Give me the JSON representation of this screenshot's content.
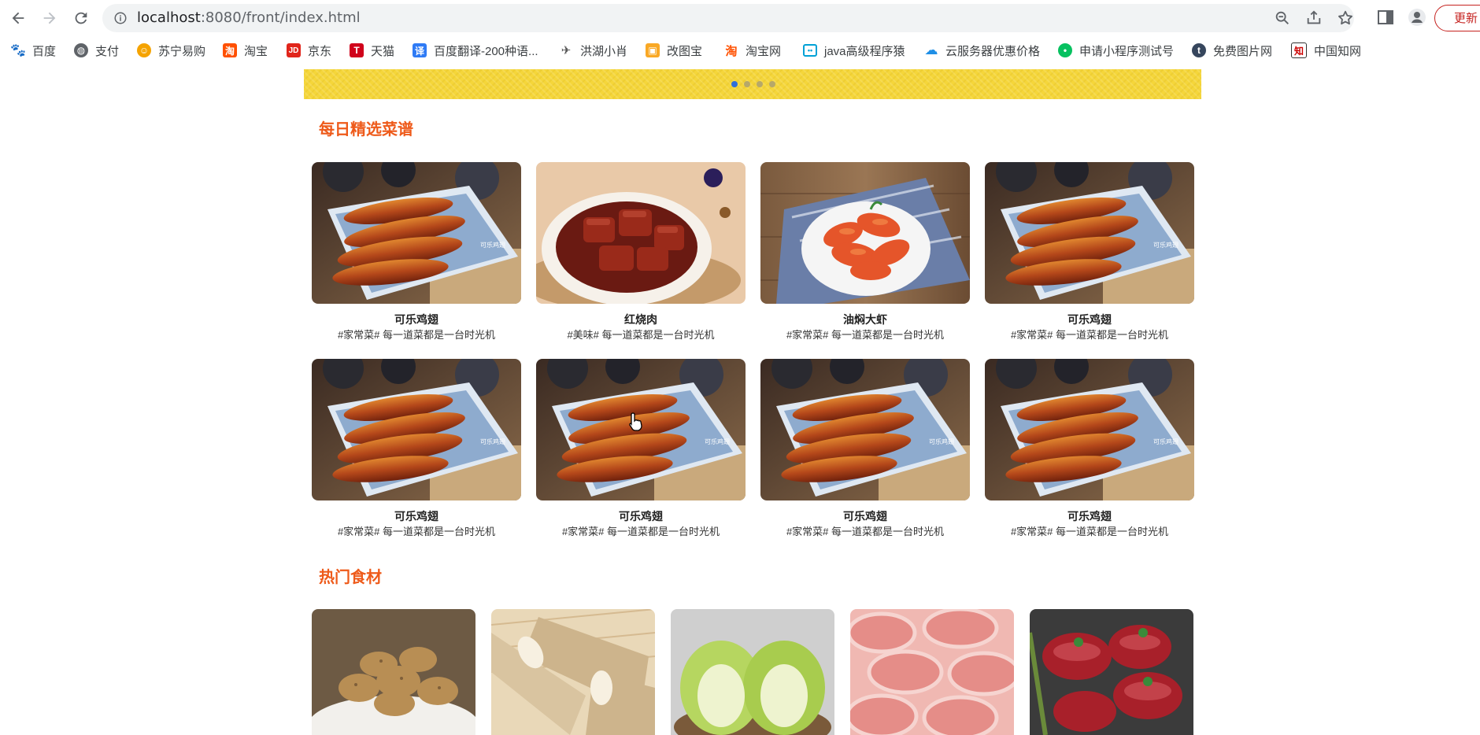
{
  "browser": {
    "url_host": "localhost",
    "url_rest": ":8080/front/index.html",
    "update_label": "更新"
  },
  "bookmarks": [
    {
      "label": "百度",
      "icon": "baidu-paw-icon",
      "color": "#2932e1"
    },
    {
      "label": "支付",
      "icon": "globe-icon",
      "color": "#5f6368"
    },
    {
      "label": "苏宁易购",
      "icon": "suning-lion-icon",
      "color": "#f5a300"
    },
    {
      "label": "淘宝",
      "icon": "taobao-icon",
      "color": "#ff5000"
    },
    {
      "label": "京东",
      "icon": "jd-icon",
      "color": "#e1251b"
    },
    {
      "label": "天猫",
      "icon": "tmall-icon",
      "color": "#d0021b"
    },
    {
      "label": "百度翻译-200种语...",
      "icon": "baidu-translate-icon",
      "color": "#2f7bf5"
    },
    {
      "label": "洪湖小肖",
      "icon": "rocket-icon",
      "color": "#555"
    },
    {
      "label": "改图宝",
      "icon": "gaitubao-icon",
      "color": "#f9a825"
    },
    {
      "label": "淘宝网",
      "icon": "taobao-icon",
      "color": "#ff5000"
    },
    {
      "label": "java高级程序猿",
      "icon": "bilibili-icon",
      "color": "#00a1d6"
    },
    {
      "label": "云服务器优惠价格",
      "icon": "cloud-icon",
      "color": "#1f8fe6"
    },
    {
      "label": "申请小程序测试号",
      "icon": "wechat-icon",
      "color": "#07c160"
    },
    {
      "label": "免费图片网",
      "icon": "tumblr-icon",
      "color": "#36465d"
    },
    {
      "label": "中国知网",
      "icon": "cnki-icon",
      "color": "#333"
    }
  ],
  "sections": {
    "daily_title": "每日精选菜谱",
    "hot_title": "热门食材"
  },
  "recipes": [
    {
      "name": "可乐鸡翅",
      "desc": "#家常菜# 每一道菜都是一台时光机",
      "image": "cola-chicken-wings"
    },
    {
      "name": "红烧肉",
      "desc": "#美味# 每一道菜都是一台时光机",
      "image": "braised-pork"
    },
    {
      "name": "油焖大虾",
      "desc": "#家常菜# 每一道菜都是一台时光机",
      "image": "braised-prawns"
    },
    {
      "name": "可乐鸡翅",
      "desc": "#家常菜# 每一道菜都是一台时光机",
      "image": "cola-chicken-wings"
    },
    {
      "name": "可乐鸡翅",
      "desc": "#家常菜# 每一道菜都是一台时光机",
      "image": "cola-chicken-wings"
    },
    {
      "name": "可乐鸡翅",
      "desc": "#家常菜# 每一道菜都是一台时光机",
      "image": "cola-chicken-wings"
    },
    {
      "name": "可乐鸡翅",
      "desc": "#家常菜# 每一道菜都是一台时光机",
      "image": "cola-chicken-wings"
    },
    {
      "name": "可乐鸡翅",
      "desc": "#家常菜# 每一道菜都是一台时光机",
      "image": "cola-chicken-wings"
    }
  ],
  "ingredients": [
    {
      "image": "potatoes"
    },
    {
      "image": "chinese-yam"
    },
    {
      "image": "napa-cabbage"
    },
    {
      "image": "lamb-rolls"
    },
    {
      "image": "beef-steak"
    }
  ],
  "carousel": {
    "count": 4,
    "active": 1
  }
}
